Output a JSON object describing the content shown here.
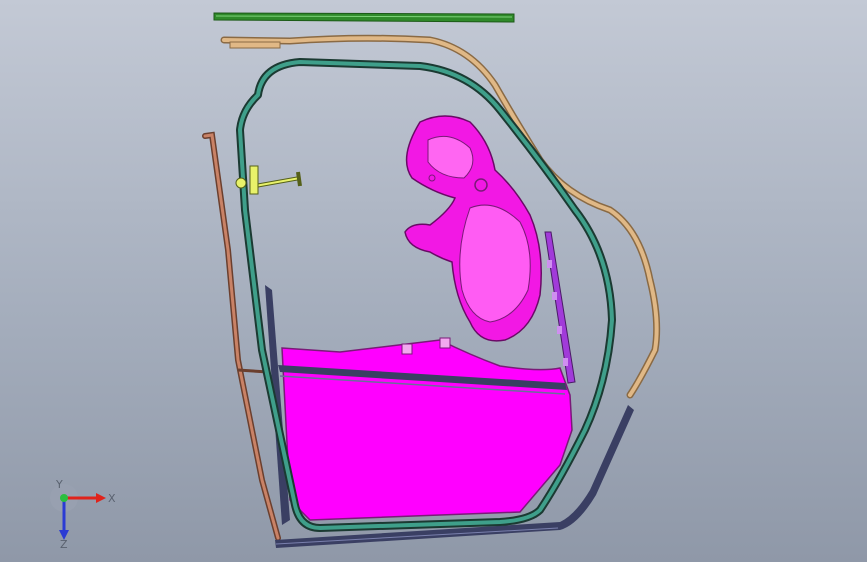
{
  "viewport": {
    "background": [
      "#c3c9d5",
      "#8f98a8"
    ],
    "parts": [
      {
        "name": "top-green-strip",
        "color": "#2f8a2a"
      },
      {
        "name": "tan-belt-rail",
        "color": "#e0b886"
      },
      {
        "name": "teal-door-frame",
        "color": "#3f9f8a"
      },
      {
        "name": "left-brown-rail",
        "color": "#c98266"
      },
      {
        "name": "yellow-handle",
        "color": "#e8f26a"
      },
      {
        "name": "magenta-inner-panel",
        "color": "#f218e4"
      },
      {
        "name": "magenta-lower-panel",
        "color": "#ff00ff"
      },
      {
        "name": "purple-bracket",
        "color": "#a13bd9"
      },
      {
        "name": "navy-frame-members",
        "color": "#3a3f63"
      }
    ]
  },
  "triad": {
    "x_label": "X",
    "y_label": "Y",
    "z_label": "Z",
    "colors": {
      "x": "#e0231b",
      "y": "#2bbf3f",
      "z": "#2b3bd4"
    }
  }
}
